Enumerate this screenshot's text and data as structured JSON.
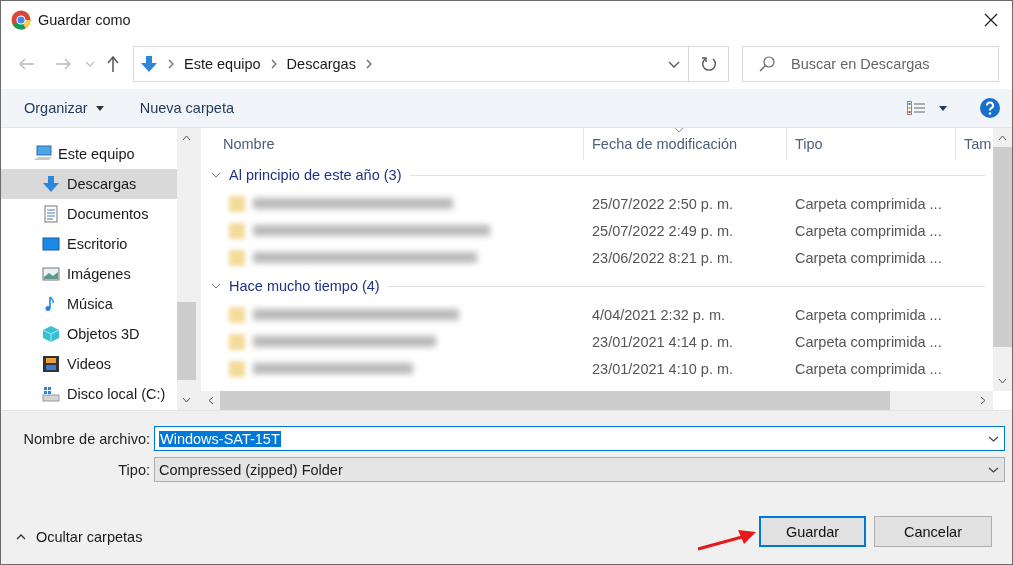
{
  "window": {
    "title": "Guardar como"
  },
  "address_bar": {
    "path": [
      "Este equipo",
      "Descargas"
    ]
  },
  "search": {
    "placeholder": "Buscar en Descargas"
  },
  "toolbar": {
    "organize": "Organizar",
    "new_folder": "Nueva carpeta"
  },
  "sidebar": {
    "items": [
      {
        "label": "Este equipo",
        "kind": "computer",
        "selected": false,
        "children": [
          {
            "label": "Descargas",
            "kind": "downloads",
            "selected": true
          },
          {
            "label": "Documentos",
            "kind": "documents",
            "selected": false
          },
          {
            "label": "Escritorio",
            "kind": "desktop",
            "selected": false
          },
          {
            "label": "Imágenes",
            "kind": "pictures",
            "selected": false
          },
          {
            "label": "Música",
            "kind": "music",
            "selected": false
          },
          {
            "label": "Objetos 3D",
            "kind": "objects3d",
            "selected": false
          },
          {
            "label": "Videos",
            "kind": "videos",
            "selected": false
          },
          {
            "label": "Disco local (C:)",
            "kind": "drive",
            "selected": false
          }
        ]
      }
    ]
  },
  "file_list": {
    "columns": [
      "Nombre",
      "Fecha de modificación",
      "Tipo",
      "Tam"
    ],
    "groups": [
      {
        "label": "Al principio de este año (3)",
        "expanded": true,
        "rows": [
          {
            "date": "25/07/2022 2:50 p. m.",
            "type": "Carpeta comprimida ..."
          },
          {
            "date": "25/07/2022 2:49 p. m.",
            "type": "Carpeta comprimida ..."
          },
          {
            "date": "23/06/2022 8:21 p. m.",
            "type": "Carpeta comprimida ..."
          }
        ]
      },
      {
        "label": "Hace mucho tiempo (4)",
        "expanded": true,
        "rows": [
          {
            "date": "4/04/2021 2:32 p. m.",
            "type": "Carpeta comprimida ..."
          },
          {
            "date": "23/01/2021 4:14 p. m.",
            "type": "Carpeta comprimida ..."
          },
          {
            "date": "23/01/2021 4:10 p. m.",
            "type": "Carpeta comprimida ..."
          }
        ]
      }
    ]
  },
  "filename": {
    "label": "Nombre de archivo:",
    "value": "Windows-SAT-15T"
  },
  "file_type": {
    "label": "Tipo:",
    "value": "Compressed (zipped) Folder"
  },
  "hide_folders": "Ocultar carpetas",
  "buttons": [
    {
      "label": "Guardar",
      "kind": "primary"
    },
    {
      "label": "Cancelar",
      "kind": "secondary"
    }
  ]
}
